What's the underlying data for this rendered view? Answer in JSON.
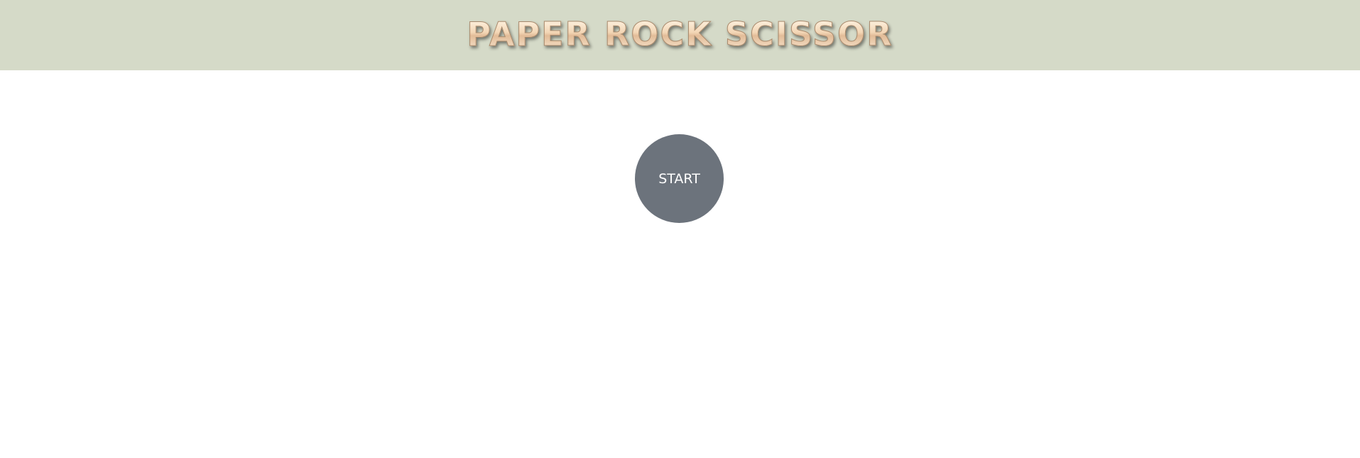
{
  "header": {
    "title": "PAPER ROCK SCISSOR"
  },
  "game": {
    "start_label": "START"
  },
  "colors": {
    "header_background": "#d5dac8",
    "start_button_background": "#6c737c",
    "start_button_text": "#ffffff",
    "page_background": "#ffffff"
  }
}
